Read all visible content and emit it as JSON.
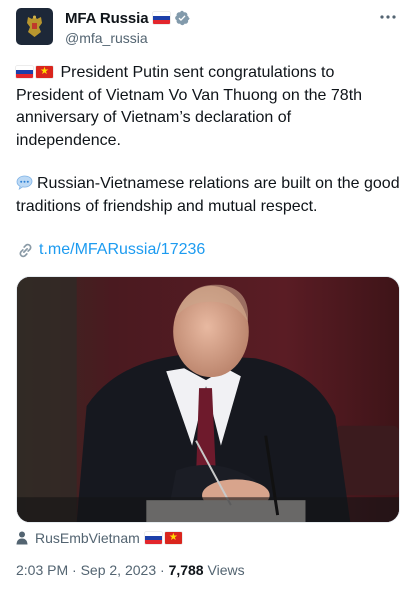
{
  "account": {
    "display_name": "MFA Russia",
    "handle": "@mfa_russia"
  },
  "tweet": {
    "paragraph_1": "President Putin sent congratulations to President of Vietnam Vo Van Thuong on the 78th anniversary of Vietnam’s declaration of independence.",
    "paragraph_2": "Russian-Vietnamese relations are built on the good traditions of friendship and mutual respect.",
    "link_text": "t.me/MFARussia/17236"
  },
  "media": {
    "tagged_account": "RusEmbVietnam"
  },
  "meta": {
    "time": "2:03 PM",
    "separator_1": " · ",
    "date": "Sep 2, 2023",
    "separator_2": " · ",
    "views_count": "7,788",
    "views_label": " Views"
  },
  "icons": {
    "verified": "verified-badge-icon",
    "more": "more-dots-icon",
    "speech": "speech-bubble-icon",
    "link": "link-icon",
    "person": "person-icon",
    "flag_ru": "russia-flag-icon",
    "flag_vn": "vietnam-flag-icon"
  },
  "colors": {
    "text": "#0f1419",
    "secondary": "#536471",
    "link": "#1d9bf0",
    "verified": "#829aab"
  }
}
